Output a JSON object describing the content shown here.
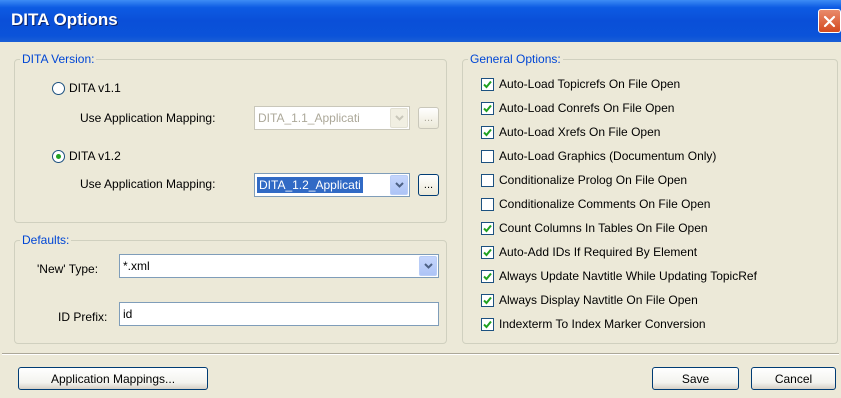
{
  "window": {
    "title": "DITA Options"
  },
  "version": {
    "legend": "DITA Version:",
    "v11": {
      "label": "DITA v1.1",
      "selected": false,
      "mapping_label": "Use Application Mapping:",
      "mapping_value": "DITA_1.1_Applicati",
      "browse": "..."
    },
    "v12": {
      "label": "DITA v1.2",
      "selected": true,
      "mapping_label": "Use Application Mapping:",
      "mapping_value": "DITA_1.2_Applicati",
      "browse": "..."
    }
  },
  "defaults": {
    "legend": "Defaults:",
    "new_type_label": "'New' Type:",
    "new_type_value": "*.xml",
    "id_prefix_label": "ID Prefix:",
    "id_prefix_value": "id"
  },
  "general": {
    "legend": "General Options:",
    "options": [
      {
        "label": "Auto-Load Topicrefs On File Open",
        "checked": true
      },
      {
        "label": "Auto-Load Conrefs On File Open",
        "checked": true
      },
      {
        "label": "Auto-Load Xrefs On File Open",
        "checked": true
      },
      {
        "label": "Auto-Load Graphics (Documentum Only)",
        "checked": false
      },
      {
        "label": "Conditionalize Prolog On File Open",
        "checked": false
      },
      {
        "label": "Conditionalize Comments On File Open",
        "checked": false
      },
      {
        "label": "Count Columns In Tables On File Open",
        "checked": true
      },
      {
        "label": "Auto-Add IDs If Required By Element",
        "checked": true
      },
      {
        "label": "Always Update Navtitle While Updating TopicRef",
        "checked": true
      },
      {
        "label": "Always Display Navtitle On File Open",
        "checked": true
      },
      {
        "label": "Indexterm To Index Marker Conversion",
        "checked": true
      }
    ]
  },
  "buttons": {
    "app_mappings": "Application Mappings...",
    "save": "Save",
    "cancel": "Cancel"
  },
  "colors": {
    "title_bar": "#0a4fd8",
    "legend_text": "#0046d5",
    "check_mark": "#21a121",
    "selection": "#316ac5"
  }
}
